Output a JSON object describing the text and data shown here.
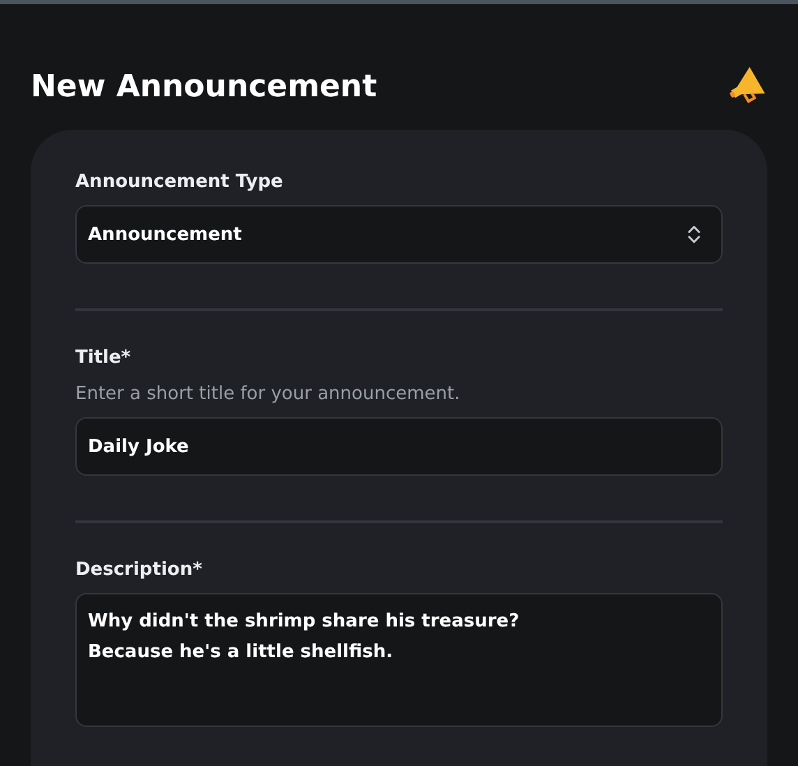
{
  "page": {
    "title": "New Announcement"
  },
  "form": [
    {
      "kind": "select",
      "label": "Announcement Type",
      "value": "Announcement"
    },
    {
      "kind": "text",
      "label": "Title*",
      "hint": "Enter a short title for your announcement.",
      "value": "Daily Joke"
    },
    {
      "kind": "textarea",
      "label": "Description*",
      "value": "Why didn't the shrimp share his treasure?\nBecause he's a little shellfish."
    }
  ]
}
